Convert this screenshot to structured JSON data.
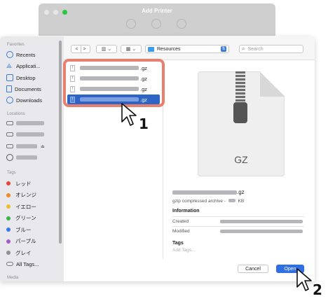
{
  "background_window": {
    "title": "Add Printer"
  },
  "sidebar": {
    "favorites_heading": "Favorites",
    "favorites": [
      {
        "label": "Recents",
        "icon": "clock-icon"
      },
      {
        "label": "Applicati...",
        "icon": "apps-icon"
      },
      {
        "label": "Desktop",
        "icon": "desktop-icon"
      },
      {
        "label": "Documents",
        "icon": "document-icon"
      },
      {
        "label": "Downloads",
        "icon": "download-icon"
      }
    ],
    "locations_heading": "Locations",
    "tags_heading": "Tags",
    "tags": [
      {
        "label": "レッド",
        "color": "#e5443b"
      },
      {
        "label": "オレンジ",
        "color": "#f08a24"
      },
      {
        "label": "イエロー",
        "color": "#e8c02b"
      },
      {
        "label": "グリーン",
        "color": "#39b54a"
      },
      {
        "label": "ブルー",
        "color": "#3478f6"
      },
      {
        "label": "パープル",
        "color": "#a45ac9"
      },
      {
        "label": "グレイ",
        "color": "#8e8e93"
      }
    ],
    "all_tags": "All Tags...",
    "media_heading": "Media"
  },
  "toolbar": {
    "back": "<",
    "forward": ">",
    "folder": "Resources",
    "search_placeholder": "Search"
  },
  "files": [
    {
      "suffix": ".gz",
      "selected": false
    },
    {
      "suffix": ".gz",
      "selected": false
    },
    {
      "suffix": ".gz",
      "selected": false
    },
    {
      "suffix": ".gz",
      "selected": true
    }
  ],
  "preview": {
    "extension": "GZ",
    "name_suffix": ".gz",
    "kind_prefix": "gzip compressed archive -",
    "size_unit": "KB",
    "information_heading": "Information",
    "created_label": "Created",
    "modified_label": "Modified",
    "tags_heading": "Tags",
    "tags_placeholder": "Add Tags..."
  },
  "buttons": {
    "cancel": "Cancel",
    "open": "Open"
  },
  "steps": {
    "one": "1",
    "two": "2"
  },
  "colors": {
    "accent": "#2f6fe0",
    "highlight": "#e8806f"
  }
}
